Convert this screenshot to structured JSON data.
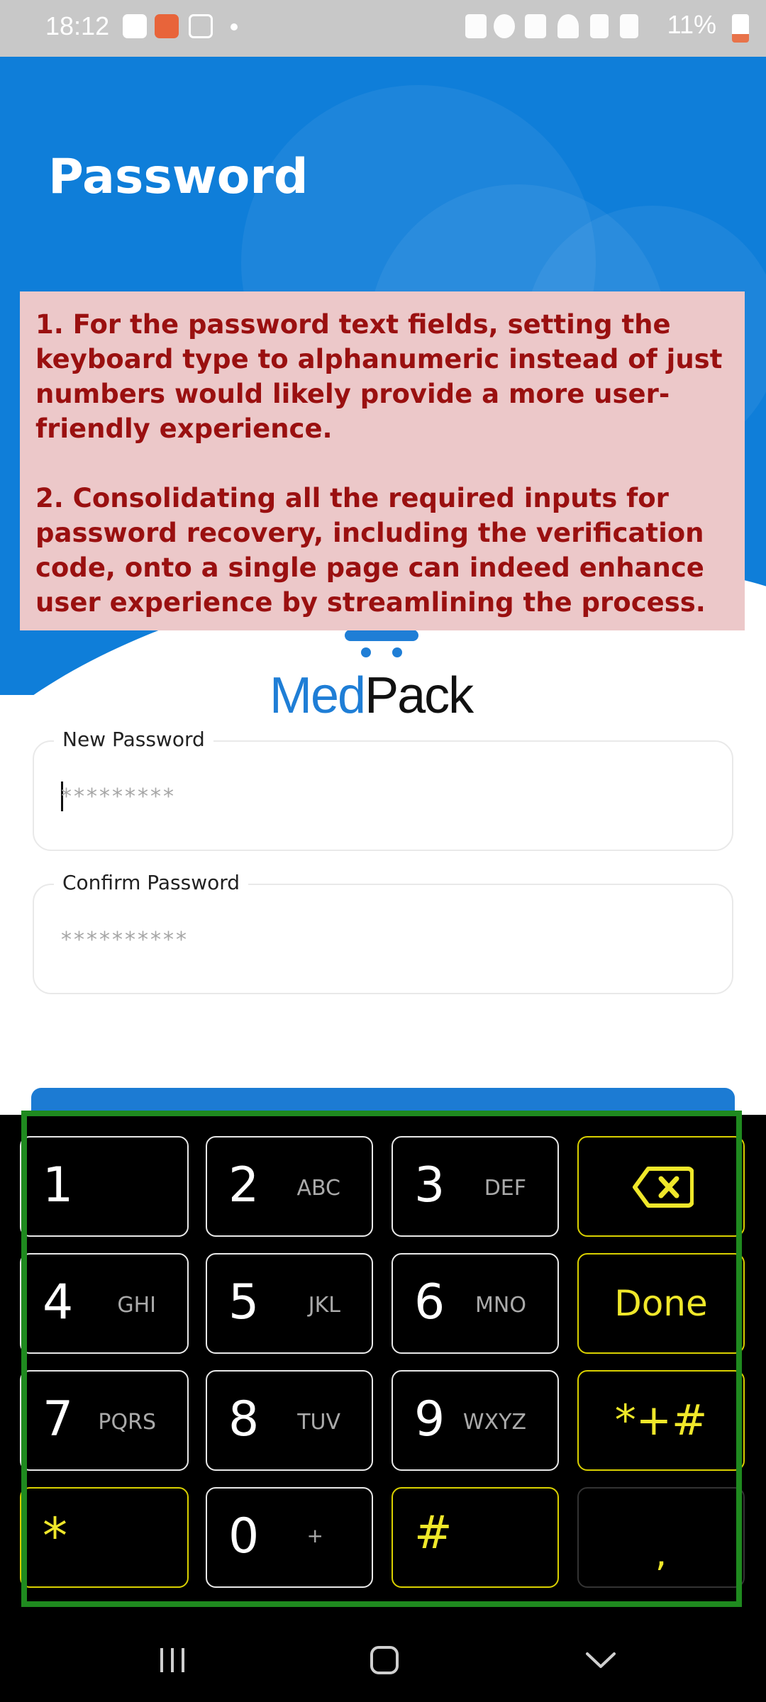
{
  "status_bar": {
    "time": "18:12",
    "battery": "11%"
  },
  "header": {
    "title": "Password"
  },
  "annotation": {
    "paragraphs": [
      "1. For the password text fields, setting the keyboard type to alphanumeric instead of just numbers would likely provide a more user-friendly experience.",
      "2. Consolidating all the required inputs for password recovery, including the verification code, onto a single page can indeed enhance user experience by streamlining the process."
    ]
  },
  "logo": {
    "part1": "Med",
    "part2": "Pack"
  },
  "form": {
    "new_password": {
      "label": "New Password",
      "placeholder": "*********",
      "value": ""
    },
    "confirm_password": {
      "label": "Confirm Password",
      "placeholder": "**********",
      "value": ""
    }
  },
  "keyboard": {
    "keys": [
      {
        "main": "1",
        "sub": ""
      },
      {
        "main": "2",
        "sub": "ABC"
      },
      {
        "main": "3",
        "sub": "DEF"
      },
      {
        "main": "4",
        "sub": "GHI"
      },
      {
        "main": "5",
        "sub": "JKL"
      },
      {
        "main": "6",
        "sub": "MNO"
      },
      {
        "main": "7",
        "sub": "PQRS"
      },
      {
        "main": "8",
        "sub": "TUV"
      },
      {
        "main": "9",
        "sub": "WXYZ"
      },
      {
        "main": "0",
        "sub": "+"
      }
    ],
    "done_label": "Done",
    "symbols_label": "*+#",
    "star_label": "*",
    "hash_label": "#",
    "comma_label": ","
  },
  "colors": {
    "accent": "#0f7ed9",
    "annotation_bg": "#ecc8c9",
    "annotation_text": "#9a1010",
    "keyboard_highlight": "#1f8a1f",
    "function_key": "#efe72a"
  },
  "icons": {
    "status_left": [
      "gallery-icon",
      "app-notification-icon",
      "video-icon"
    ],
    "status_right": [
      "lock-icon",
      "alarm-icon",
      "mute-icon",
      "wifi-icon",
      "signal-icon",
      "signal-icon"
    ],
    "keyboard": [
      "backspace-icon"
    ],
    "nav": [
      "recents-icon",
      "home-icon",
      "back-down-icon"
    ]
  }
}
